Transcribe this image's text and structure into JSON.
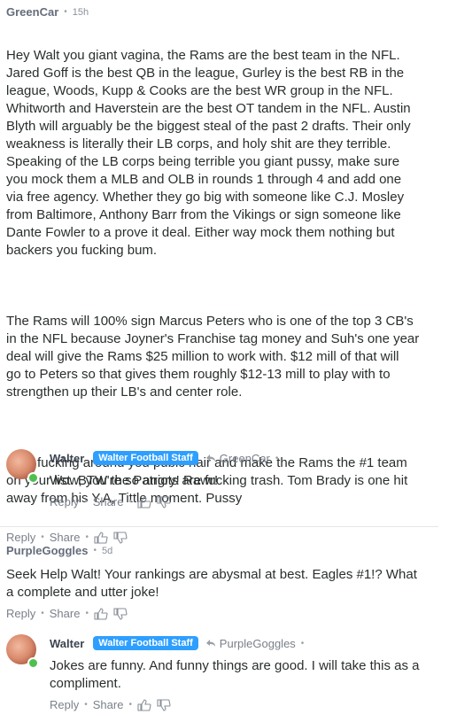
{
  "c1": {
    "author": "GreenCar",
    "time": "15h",
    "paragraphs": [
      "Hey Walt you giant vagina, the Rams are the best team in the NFL.\nJared Goff is the best QB in the league, Gurley is the best RB in the\nleague, Woods, Kupp & Cooks are the best WR group in the NFL.\nWhitworth and Haverstein are the best OT tandem in the NFL. Austin\nBlyth will arguably be the biggest steal of the past 2 drafts. Their only\nweakness is literally their LB corps, and holy shit are they terrible.\nSpeaking of the LB corps being terrible you giant pussy, make sure\nyou mock them a MLB and OLB in rounds 1 through 4 and add one\nvia free agency. Whether they go big with someone like C.J. Mosley\nfrom Baltimore, Anthony Barr from the Vikings or sign someone like\nDante Fowler to a prove it deal. Either way mock them nothing but\nbackers you fucking bum.",
      "The Rams will 100% sign Marcus Peters who is one of the top 3 CB's\nin the NFL because Joyner's Franchise tag money and Suh's one year\ndeal will give the Rams $25 million to work with. $12 mill of that will\ngo to Peters so that gives them roughly $12-13 mill to play with to\nstrengthen up their LB's and center role.",
      "Stop fucking around you pubic hair and make the Rams the #1 team\non your list. BTW the Patriots are fucking trash. Tom Brady is one hit\naway from his Y.A, Tittle moment. Pussy"
    ]
  },
  "r1": {
    "author": "Walter",
    "badge": "Walter Football Staff",
    "reply_to": "GreenCar",
    "text": "Wow, you're so angry! Rawr!"
  },
  "c2": {
    "author": "PurpleGoggles",
    "time": "5d",
    "text": "Seek Help Walt! Your rankings are abysmal at best. Eagles #1!? What\na complete and utter joke!"
  },
  "r2": {
    "author": "Walter",
    "badge": "Walter Football Staff",
    "reply_to": "PurpleGoggles",
    "text": "Jokes are funny. And funny things are good. I will take this as a\ncompliment."
  },
  "actions": {
    "reply": "Reply",
    "share": "Share"
  },
  "colors": {
    "badge": "#2e9fff",
    "online": "#4fc04f"
  }
}
